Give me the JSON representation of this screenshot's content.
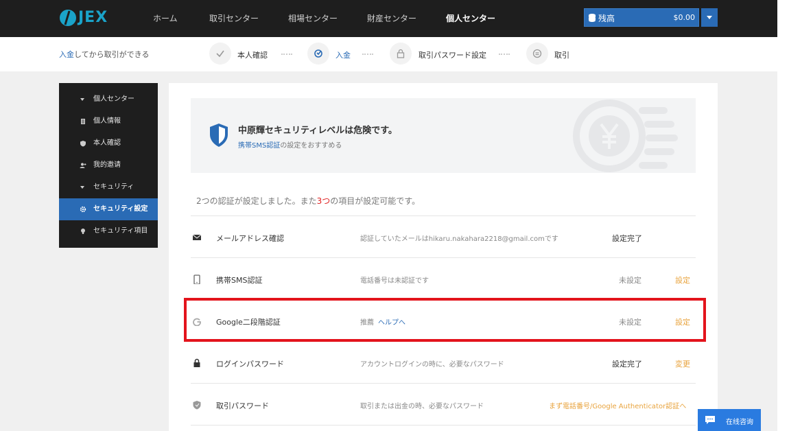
{
  "brand": {
    "logo_text": "JEX",
    "accent": "#1aa3c9"
  },
  "nav": {
    "items": [
      {
        "label": "ホーム"
      },
      {
        "label": "取引センター"
      },
      {
        "label": "相場センター"
      },
      {
        "label": "財産センター"
      },
      {
        "label": "個人センター",
        "active": true
      }
    ]
  },
  "balance": {
    "label": "残高",
    "amount": "$0.00",
    "icon": "coin-stack-icon"
  },
  "steps": {
    "hint_prefix": "入金",
    "hint_rest": "してから取引ができる",
    "items": [
      {
        "label": "本人確認",
        "icon": "check-icon"
      },
      {
        "label": "入金",
        "icon": "deposit-icon",
        "current": true
      },
      {
        "label": "取引パスワード設定",
        "icon": "lock-icon"
      },
      {
        "label": "取引",
        "icon": "exchange-icon"
      }
    ]
  },
  "sidebar": {
    "items": [
      {
        "label": "個人センター",
        "icon": "caret-down-icon"
      },
      {
        "label": "個人情報",
        "icon": "document-icon"
      },
      {
        "label": "本人確認",
        "icon": "shield-icon"
      },
      {
        "label": "我的邀请",
        "icon": "user-add-icon"
      },
      {
        "label": "セキュリティ",
        "icon": "caret-down-icon"
      },
      {
        "label": "セキュリティ設定",
        "icon": "gear-icon",
        "active": true
      },
      {
        "label": "セキュリティ項目",
        "icon": "bulb-icon"
      }
    ]
  },
  "banner": {
    "title": "中原輝セキュリティレベルは危険です。",
    "sub_link": "携帯SMS認証",
    "sub_rest": "の設定をおすすめる"
  },
  "summary": {
    "pre": "2つの認証が設定しました。また",
    "num": "3つ",
    "post": "の項目が設定可能です。"
  },
  "rows": [
    {
      "name": "メールアドレス確認",
      "desc": "認証していたメールはhikaru.nakahara2218@gmail.comです",
      "status": "設定完了",
      "action": "",
      "icon": "mail-icon"
    },
    {
      "name": "携帯SMS認証",
      "desc": "電話番号は未認証です",
      "status": "未設定",
      "action": "設定",
      "icon": "phone-icon"
    },
    {
      "name": "Google二段階認証",
      "desc": "推薦",
      "desc_link": "ヘルプへ",
      "status": "未設定",
      "action": "設定",
      "icon": "google-icon"
    },
    {
      "name": "ログインパスワード",
      "desc": "アカウントログインの時に、必要なパスワード",
      "status": "設定完了",
      "action": "変更",
      "icon": "lock-icon"
    },
    {
      "name": "取引パスワード",
      "desc": "取引または出金の時、必要なパスワード",
      "status": "",
      "action": "まず電話番号/Google Authenticator認証へ",
      "icon": "shield-icon"
    }
  ],
  "chat": {
    "label": "在线咨询"
  }
}
